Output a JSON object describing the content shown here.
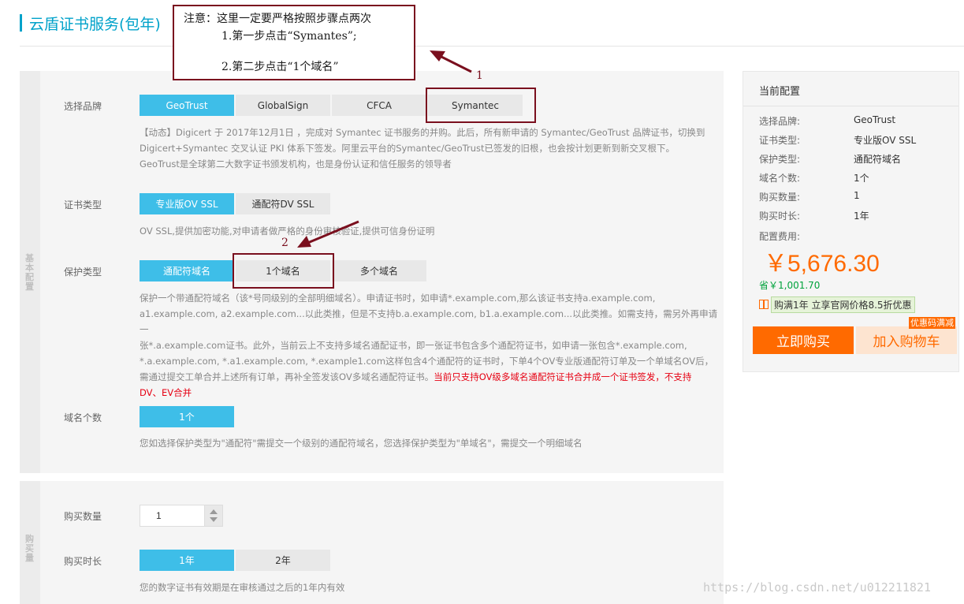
{
  "header": {
    "title": "云盾证书服务(包年)"
  },
  "sections": {
    "basic_label": "基本配置",
    "buy_label": "购买量"
  },
  "brand": {
    "label": "选择品牌",
    "options": [
      "GeoTrust",
      "GlobalSign",
      "CFCA",
      "Symantec"
    ],
    "selected": "GeoTrust",
    "desc_line1": "【动态】Digicert 于 2017年12月1日 ，完成对 Symantec 证书服务的并购。此后，所有新申请的 Symantec/GeoTrust 品牌证书，切换到",
    "desc_line2": "Digicert+Symantec 交叉认证 PKI 体系下签发。阿里云平台的Symantec/GeoTrust已签发的旧根，也会按计划更新到新交叉根下。",
    "desc_line3": "GeoTrust是全球第二大数字证书颁发机构，也是身份认证和信任服务的领导者"
  },
  "cert_type": {
    "label": "证书类型",
    "options": [
      "专业版OV SSL",
      "通配符DV SSL"
    ],
    "selected": "专业版OV SSL",
    "desc": "OV SSL,提供加密功能,对申请者做严格的身份审核验证,提供可信身份证明"
  },
  "protect_type": {
    "label": "保护类型",
    "options": [
      "通配符域名",
      "1个域名",
      "多个域名"
    ],
    "selected": "通配符域名",
    "desc_line1": "保护一个带通配符域名（该*号同级别的全部明细域名）。申请证书时，如申请*.example.com,那么该证书支持a.example.com,",
    "desc_line2": "a1.example.com, a2.example.com...以此类推，但是不支持b.a.example.com, b1.a.example.com...以此类推。如需支持，需另外再申请一",
    "desc_line3": "张*.a.example.com证书。此外，当前云上不支持多域名通配证书，即一张证书包含多个通配符证书，如申请一张包含*.example.com,",
    "desc_line4": "*.a.example.com, *.a1.example.com, *.example1.com这样包含4个通配符的证书时，下单4个OV专业版通配符订单及一个单域名OV后，",
    "desc_line5": "需通过提交工单合并上述所有订单，再补全签发该OV多域名通配符证书。",
    "desc_warn_a": "当前只支持OV级多域名通配符证书合并成一个证书签发，不支持",
    "desc_warn_b": "DV、EV合并"
  },
  "domain_count": {
    "label": "域名个数",
    "options": [
      "1个"
    ],
    "selected": "1个",
    "desc": "您如选择保护类型为\"通配符\"需提交一个级别的通配符域名，您选择保护类型为\"单域名\"，需提交一个明细域名"
  },
  "quantity": {
    "label": "购买数量",
    "value": "1"
  },
  "duration": {
    "label": "购买时长",
    "options": [
      "1年",
      "2年"
    ],
    "selected": "1年",
    "desc": "您的数字证书有效期是在审核通过之后的1年内有效"
  },
  "summary": {
    "title": "当前配置",
    "rows": [
      {
        "label": "选择品牌:",
        "value": "GeoTrust"
      },
      {
        "label": "证书类型:",
        "value": "专业版OV SSL"
      },
      {
        "label": "保护类型:",
        "value": "通配符域名"
      },
      {
        "label": "域名个数:",
        "value": "1个"
      },
      {
        "label": "购买数量:",
        "value": "1"
      },
      {
        "label": "购买时长:",
        "value": "1年"
      }
    ],
    "fee_label": "配置费用:",
    "price": "￥5,676.30",
    "saving": "省￥1,001.70",
    "promo": "购满1年 立享官网价格8.5折优惠",
    "buy_button": "立即购买",
    "cart_button": "加入购物车",
    "cart_tag": "优惠码满减"
  },
  "annotation": {
    "note_line1": "注意：这里一定要严格按照步骤点两次",
    "note_line2": "1.第一步点击“Symantes”;",
    "note_line3": "2.第二步点击“1个域名”",
    "marker1": "1",
    "marker2": "2",
    "color": "#7a0f1e"
  },
  "watermark": "https://blog.csdn.net/u012211821",
  "colors": {
    "accent": "#3ebee8",
    "title": "#00a2ca",
    "price": "#ff6a00",
    "warn": "#e60012"
  }
}
